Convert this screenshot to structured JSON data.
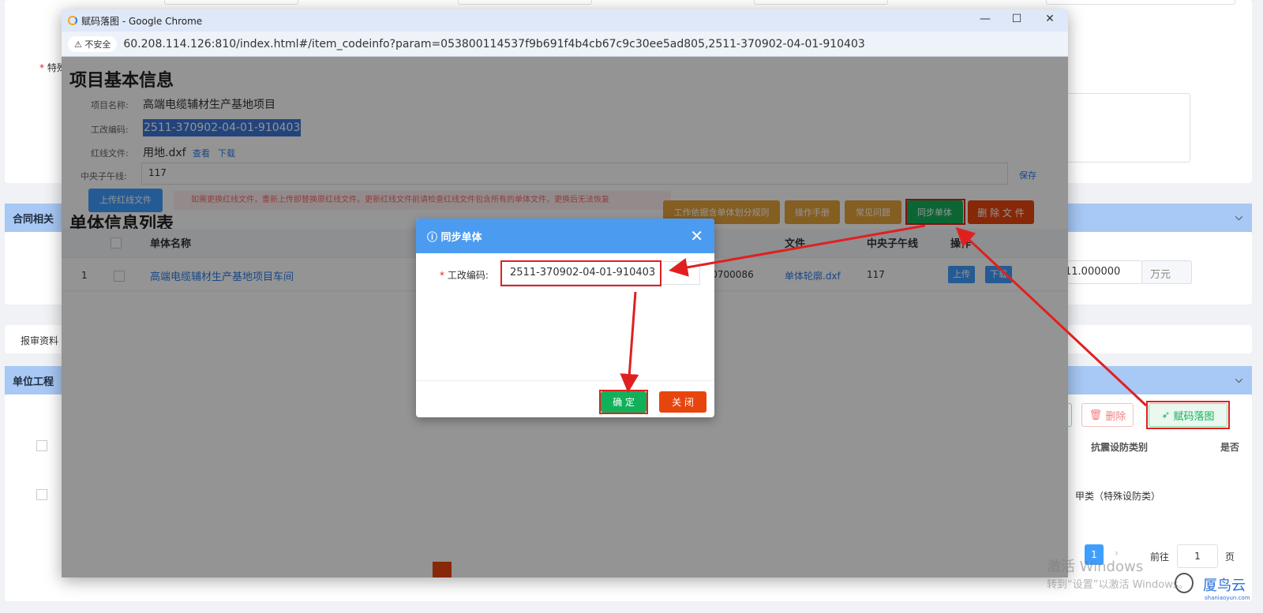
{
  "background": {
    "field_label": "特殊",
    "section_contract": "合同相关",
    "tab_review": "报审资料",
    "section_unit": "单位工程",
    "amount_value": "11.000000",
    "amount_unit": "万元",
    "delete_button": "删除",
    "code_map_button": "赋码落图",
    "col_seismic": "抗震设防类别",
    "col_is": "是否",
    "row_seismic": "甲类（特殊设防类）",
    "pagination": {
      "current": "1",
      "goto": "前往",
      "page_value": "1",
      "page_unit": "页"
    },
    "activate_title": "激活 Windows",
    "activate_sub": "转到“设置”以激活 Windows。",
    "watermark_name": "厦鸟云",
    "watermark_sub": "shaniaoyun.com"
  },
  "browser": {
    "title": "赋码落图 - Google Chrome",
    "not_secure": "不安全",
    "url": "60.208.114.126:810/index.html#/item_codeinfo?param=053800114537f9b691f4b4cb67c9c30ee5ad805,2511-370902-04-01-910403",
    "minimize": "—",
    "maximize": "☐",
    "close": "✕"
  },
  "project": {
    "heading": "项目基本信息",
    "name_label": "项目名称:",
    "name_value": "高端电缆辅材生产基地项目",
    "code_label": "工改编码:",
    "code_value": "2511-370902-04-01-910403",
    "redline_label": "红线文件:",
    "redline_value": "用地.dxf",
    "view_link": "查看",
    "download_link": "下载",
    "meridian_label": "中央子午线:",
    "meridian_value": "117",
    "save_link": "保存",
    "upload_redline": "上传红线文件",
    "warning": "如需更换红线文件，重新上传即替换原红线文件。更新红线文件前请检查红线文件包含所有的单体文件，更换后无法恢复"
  },
  "units": {
    "heading": "单体信息列表",
    "buttons": {
      "rules": "工作依据含单体划分规则",
      "manual": "操作手册",
      "faq": "常见问题",
      "sync": "同步单体",
      "delete_file": "删 除 文 件"
    },
    "columns": {
      "name": "单体名称",
      "file": "文件",
      "meridian": "中央子午线",
      "ops": "操作"
    },
    "rows": [
      {
        "index": "1",
        "name": "高端电缆辅材生产基地项目车间",
        "code_tail": "260700086",
        "file": "单体轮廓.dxf",
        "meridian": "117",
        "upload": "上传",
        "download": "下载"
      }
    ]
  },
  "dialog": {
    "title": "同步单体",
    "code_label": "工改编码:",
    "code_value": "2511-370902-04-01-910403",
    "confirm": "确 定",
    "close": "关 闭"
  },
  "colors": {
    "accent": "#4b9bf0",
    "annotation": "#e02020",
    "green": "#13b05a",
    "orange": "#e6a23c",
    "red": "#e8450e"
  }
}
